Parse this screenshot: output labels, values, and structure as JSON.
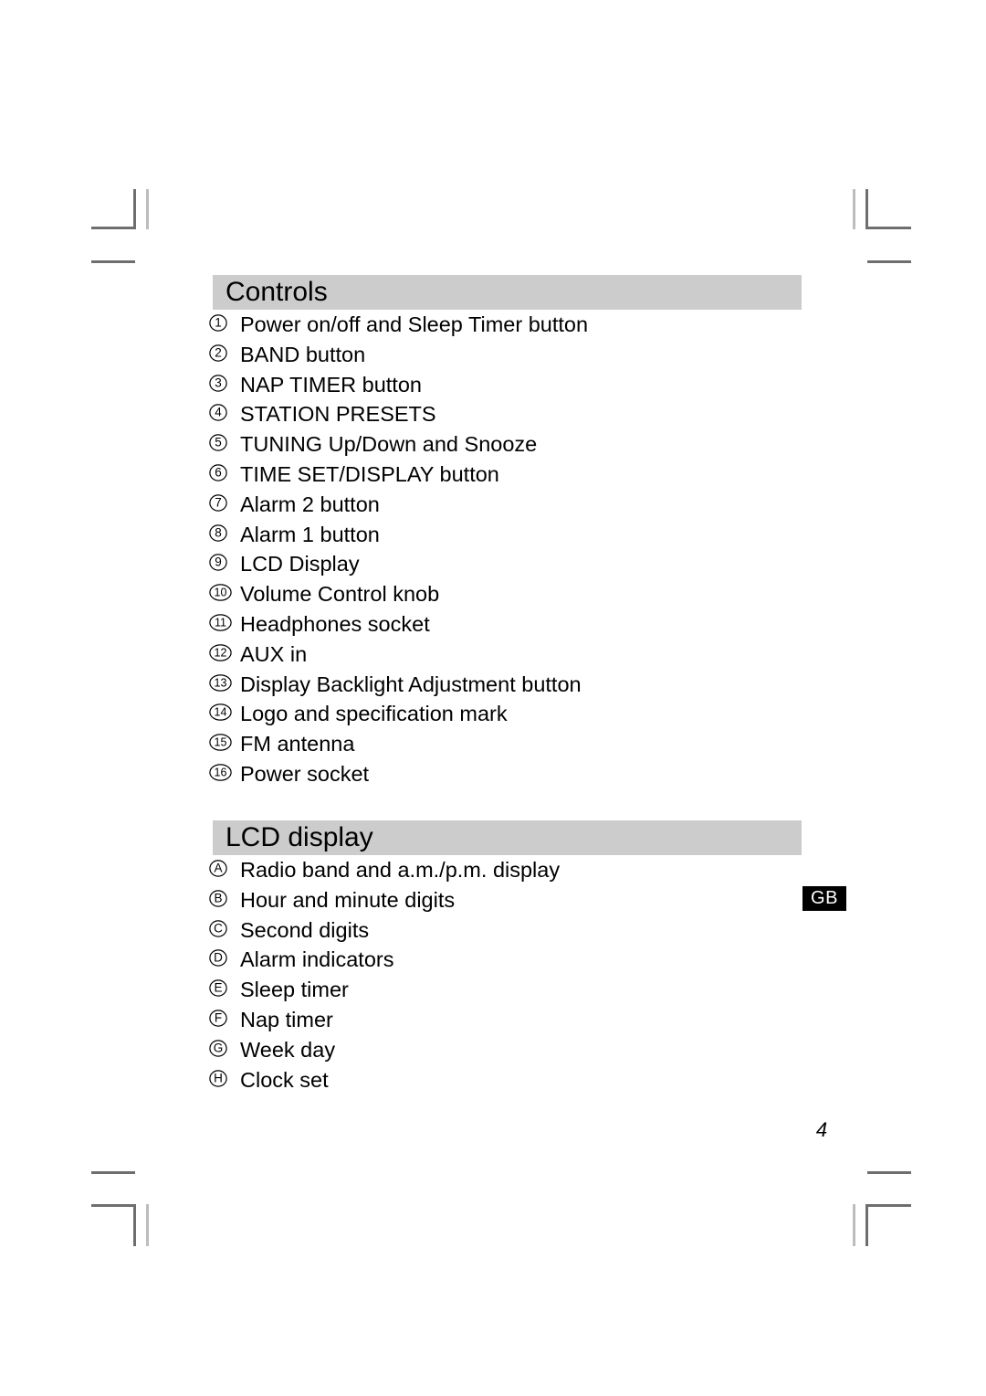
{
  "page": {
    "number": "4",
    "language_badge": "GB"
  },
  "sections": [
    {
      "id": "controls",
      "title": "Controls",
      "marker_style": "circled-number",
      "items": [
        {
          "marker": "1",
          "label": "Power on/off and Sleep Timer button"
        },
        {
          "marker": "2",
          "label": "BAND button"
        },
        {
          "marker": "3",
          "label": "NAP TIMER button"
        },
        {
          "marker": "4",
          "label": "STATION PRESETS"
        },
        {
          "marker": "5",
          "label": "TUNING Up/Down and Snooze"
        },
        {
          "marker": "6",
          "label": "TIME SET/DISPLAY button"
        },
        {
          "marker": "7",
          "label": "Alarm 2 button"
        },
        {
          "marker": "8",
          "label": "Alarm 1 button"
        },
        {
          "marker": "9",
          "label": "LCD Display"
        },
        {
          "marker": "10",
          "label": "Volume Control knob"
        },
        {
          "marker": "11",
          "label": "Headphones socket"
        },
        {
          "marker": "12",
          "label": "AUX in"
        },
        {
          "marker": "13",
          "label": "Display Backlight Adjustment button"
        },
        {
          "marker": "14",
          "label": "Logo and specification mark"
        },
        {
          "marker": "15",
          "label": "FM antenna"
        },
        {
          "marker": "16",
          "label": "Power socket"
        }
      ]
    },
    {
      "id": "lcd-display",
      "title": "LCD display",
      "marker_style": "circled-letter",
      "items": [
        {
          "marker": "A",
          "label": "Radio band and a.m./p.m. display"
        },
        {
          "marker": "B",
          "label": "Hour and minute digits"
        },
        {
          "marker": "C",
          "label": "Second digits"
        },
        {
          "marker": "D",
          "label": "Alarm indicators"
        },
        {
          "marker": "E",
          "label": "Sleep timer"
        },
        {
          "marker": "F",
          "label": "Nap timer"
        },
        {
          "marker": "G",
          "label": "Week day"
        },
        {
          "marker": "H",
          "label": "Clock set"
        }
      ]
    }
  ],
  "colors": {
    "section_bar": "#cccccc",
    "badge_background": "#000000",
    "badge_text": "#ffffff",
    "text": "#000000",
    "crop_mark": "#6e6e6e"
  }
}
